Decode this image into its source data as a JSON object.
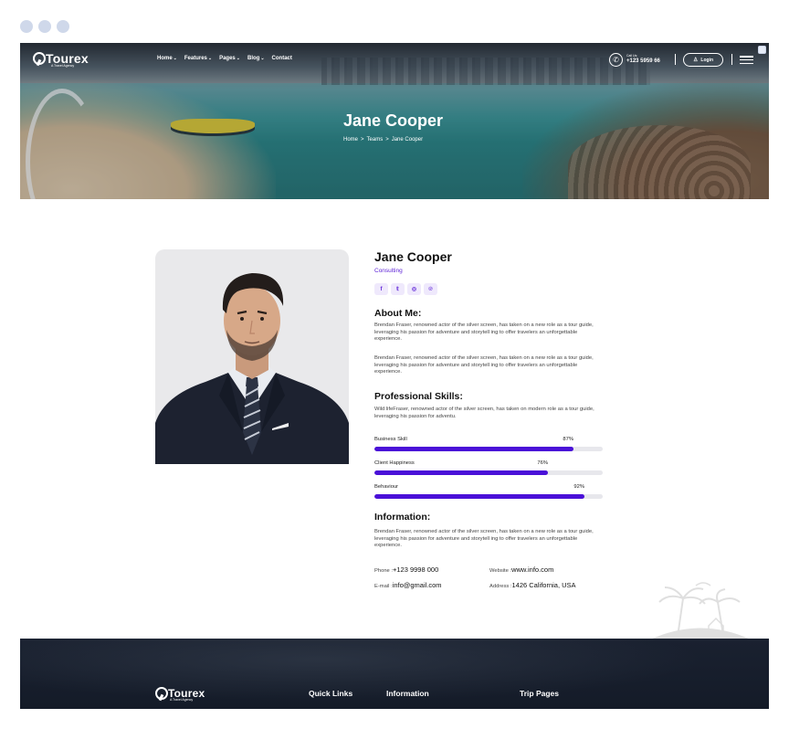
{
  "brand": {
    "name": "Tourex",
    "tagline": "A Travel Agency"
  },
  "nav": {
    "items": [
      {
        "label": "Home",
        "chevron": true
      },
      {
        "label": "Features",
        "chevron": true
      },
      {
        "label": "Pages",
        "chevron": true
      },
      {
        "label": "Blog",
        "chevron": true
      },
      {
        "label": "Contact",
        "chevron": false
      }
    ],
    "call_label": "Call Us:",
    "call_number": "+123 5959 66",
    "login_label": "Login"
  },
  "hero": {
    "title": "Jane Cooper",
    "breadcrumb": [
      "Home",
      ">",
      "Teams",
      ">",
      "Jane Cooper"
    ]
  },
  "profile": {
    "name": "Jane Cooper",
    "role": "Consulting",
    "socials": [
      "f",
      "t",
      "o",
      "p"
    ],
    "about_heading": "About Me:",
    "about_p1": "Brendan Fraser, renowned actor of the silver screen, has taken on a new role as a tour guide, leveraging his passion for adventure and storytell ing to offer travelers an unforgettable experience.",
    "about_p2": "Brendan Fraser, renowned actor of the silver screen, has taken on a new role as a tour guide, leveraging his passion for adventure and storytell ing to offer travelers an unforgettable experience.",
    "skills_heading": "Professional Skills:",
    "skills_text": "Wild lifeFraser, renowned actor of the silver screen, has taken on modern role as a tour guide, leveraging his passion for adventu.",
    "skills": [
      {
        "name": "Business Skill",
        "percent_label": "87%",
        "value": 87
      },
      {
        "name": "Client Happiness",
        "percent_label": "76%",
        "value": 76
      },
      {
        "name": "Behaviour",
        "percent_label": "92%",
        "value": 92
      }
    ],
    "info_heading": "Information:",
    "info_text": "Brendan Fraser, renowned actor of the silver screen, has taken on a new role as a tour guide, leveraging his passion for adventure and storytell ing to offer travelers an unforgettable experience.",
    "phone_label": "Phone :",
    "phone": "+123 9998 000",
    "website_label": "Website :",
    "website": "www.info.com",
    "email_label": "E-mail :",
    "email": "info@gmail.com",
    "address_label": "Address :",
    "address": "1426 California, USA"
  },
  "footer": {
    "columns": [
      "Quick Links",
      "Information",
      "Trip Pages"
    ]
  },
  "colors": {
    "accent": "#4a10d8",
    "accent_text": "#5b1fd6",
    "footer_bg": "#161d2a"
  }
}
